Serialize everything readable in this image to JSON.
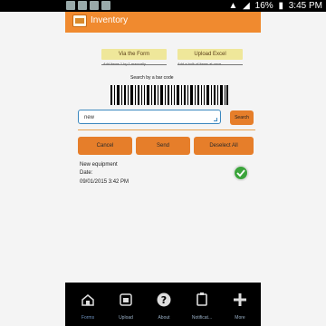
{
  "status_bar": {
    "battery": "16%",
    "time": "3:45 PM"
  },
  "action_bar": {
    "title": "Inventory",
    "logo_icon": "inventory-app-icon"
  },
  "tabs": {
    "form_label": "Via the Form",
    "form_sub": "Add items 1 by 1 manually",
    "excel_label": "Upload Excel",
    "excel_sub": "Add a bulk of items at once"
  },
  "barcode": {
    "label": "Search by a bar code"
  },
  "search": {
    "value": "new",
    "button_label": "Search"
  },
  "actions": {
    "cancel": "Cancel",
    "send": "Send",
    "deselect_all": "Deselect All"
  },
  "item": {
    "title": "New equipment",
    "date_label": "Date:",
    "date_value": "09/01/2015 3:42 PM"
  },
  "bottom_nav": [
    {
      "label": "Forms",
      "icon": "forms-icon",
      "active": true
    },
    {
      "label": "Upload",
      "icon": "upload-icon",
      "active": false
    },
    {
      "label": "About",
      "icon": "about-icon",
      "active": false
    },
    {
      "label": "Notificat...",
      "icon": "notification-icon",
      "active": false
    },
    {
      "label": "More",
      "icon": "plus-icon",
      "active": false
    }
  ],
  "colors": {
    "accent": "#f08a2f",
    "tab_bg": "#efe79a",
    "check": "#3ba43b"
  }
}
